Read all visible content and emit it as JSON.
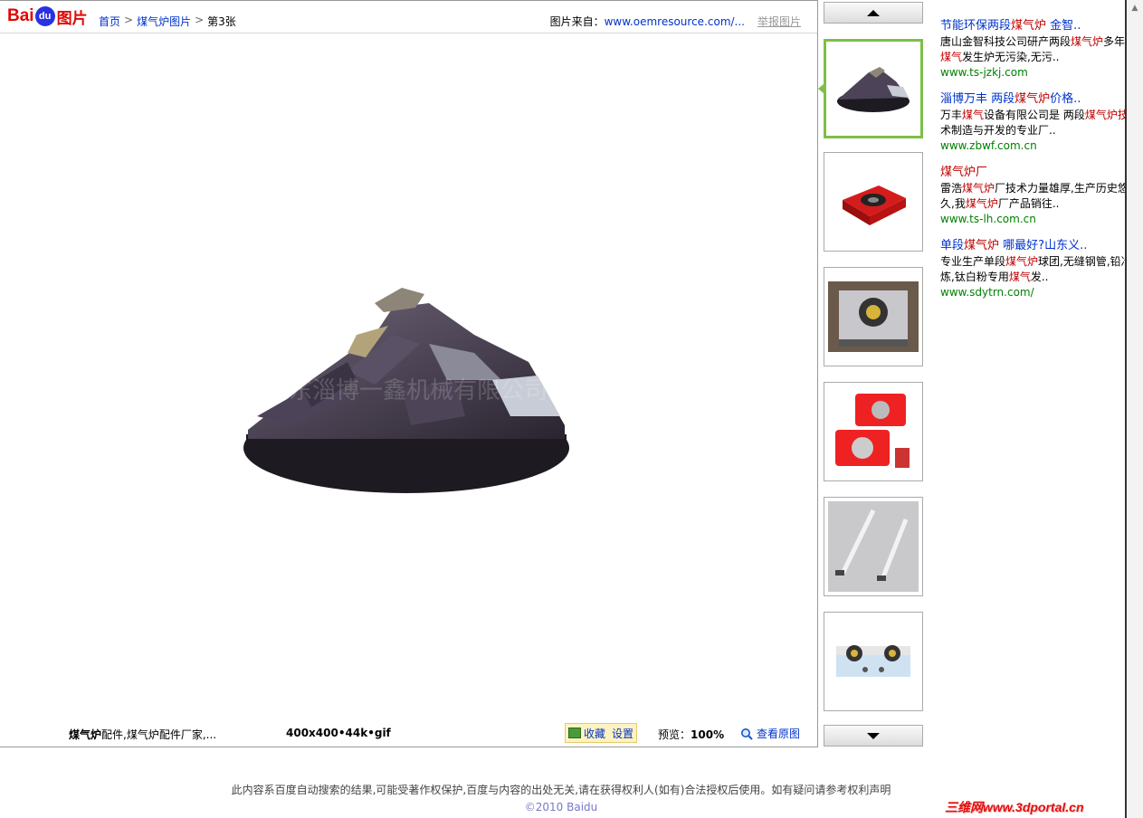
{
  "header": {
    "logo_bai": "Bai",
    "logo_du": "du",
    "logo_suffix": "图片",
    "breadcrumb": [
      "首页",
      "煤气炉图片",
      "第3张"
    ],
    "source_label": "图片来自：",
    "source_url": "www.oemresource.com/...",
    "report_label": "举报图片"
  },
  "image": {
    "watermark_text": "山东淄博一鑫机械有限公司"
  },
  "bottom": {
    "caption_bold": "煤气炉",
    "caption_rest": "配件,煤气炉配件厂家,...",
    "meta": "400x400•44k•gif",
    "fav_label": "收藏",
    "settings_label": "设置",
    "preview_label": "预览：",
    "preview_value": "100%",
    "view_original": "查看原图"
  },
  "thumbnails": [
    "gear-cone",
    "red-stove",
    "steel-stove",
    "red-stoves-pair",
    "brushes",
    "double-stove"
  ],
  "ads": [
    {
      "title_parts": [
        "节能环保两段",
        "煤气炉",
        " 金智.."
      ],
      "desc_lines": [
        [
          "唐山金智科技公司研产两段",
          "煤气炉",
          "多年"
        ],
        [
          "",
          "煤气",
          "发生炉无污染,无污.."
        ]
      ],
      "url": "www.ts-jzkj.com"
    },
    {
      "title_parts": [
        "淄博万丰 两段",
        "煤气炉",
        "价格.."
      ],
      "desc_lines": [
        [
          "万丰",
          "煤气",
          "设备有限公司是 两段"
        ],
        [
          "",
          "",
          "术制造与开发的专业厂.."
        ]
      ],
      "desc_tail": "煤气炉技",
      "url": "www.zbwf.com.cn"
    },
    {
      "title_parts": [
        "",
        "煤气炉",
        "厂"
      ],
      "desc_lines": [
        [
          "雷浩",
          "煤气炉",
          "厂技术力量雄厚,生产历史悠"
        ],
        [
          "久,我",
          "煤气炉",
          "厂产品销往.."
        ]
      ],
      "url": "www.ts-lh.com.cn"
    },
    {
      "title_parts": [
        "单段",
        "煤气炉",
        " 哪最好?山东义.."
      ],
      "desc_lines": [
        [
          "专业生产单段",
          "煤气炉",
          "球团,无缝钢管,铅冶"
        ],
        [
          "炼,钛白粉专用",
          "煤气",
          "发.."
        ]
      ],
      "url": "www.sdytrn.com/"
    }
  ],
  "footer": {
    "disclaimer": "此内容系百度自动搜索的结果,可能受著作权保护,百度与内容的出处无关,请在获得权利人(如有)合法授权后使用。如有疑问请参考权利声明",
    "copyright": "©2010 Baidu",
    "watermark": "三维网www.3dportal.cn"
  },
  "colors": {
    "brand_red": "#e10602",
    "brand_blue": "#2932e1",
    "link_blue": "#0033cc",
    "ad_green": "#008000",
    "highlight_red": "#c00000",
    "active_thumb": "#7dbf47"
  }
}
